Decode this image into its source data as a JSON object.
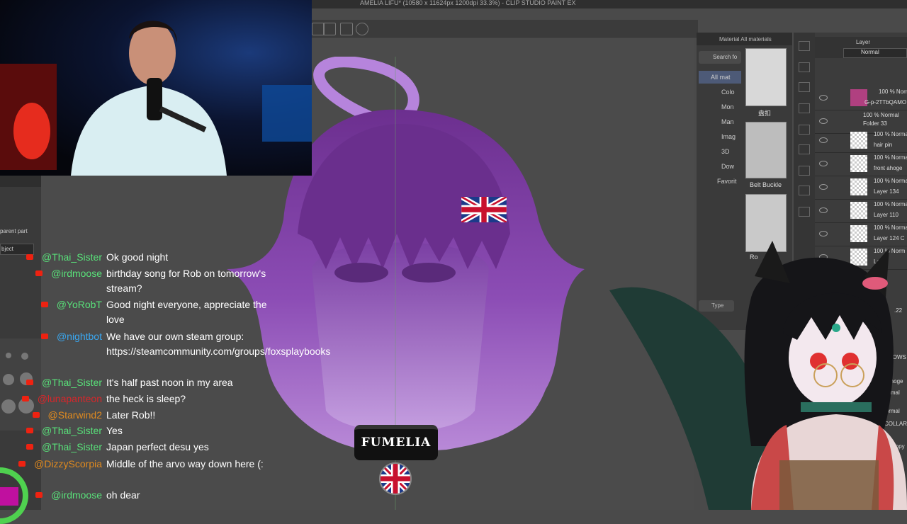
{
  "window": {
    "title": "AMELIA LIFU* (10580 x 11624px 1200dpi 33.3%) - CLIP STUDIO PAINT EX"
  },
  "material_panel": {
    "header": "Material  All materials",
    "search_label": "Search fo",
    "tree": [
      "All mat",
      "Colo",
      "Mon",
      "Man",
      "Imag",
      "3D",
      "Dow",
      "Favorit"
    ],
    "thumbs": [
      {
        "label": "盘扣"
      },
      {
        "label": "Belt Buckle"
      },
      {
        "label": "Ro"
      }
    ],
    "type_label": "Type"
  },
  "layer_panel": {
    "header": "Layer",
    "blend_mode": "Normal",
    "layers": [
      {
        "top": "100 % Norm",
        "name": "G-p-2TTbQAMO"
      },
      {
        "top": "100 % Normal",
        "name": "Folder 33"
      },
      {
        "top": "100 % Norma",
        "name": "hair pin"
      },
      {
        "top": "100 % Norma",
        "name": "front ahoge"
      },
      {
        "top": "100 % Norma",
        "name": "Layer 134"
      },
      {
        "top": "100 % Norma",
        "name": "Layer 110"
      },
      {
        "top": "100 % Norma",
        "name": "Layer 124 C"
      },
      {
        "top": "100 % Norm",
        "name": "Layer"
      }
    ],
    "partial_labels": [
      ".22",
      "ROWS",
      "k ahoge",
      "Normal",
      "Normal",
      "COLLAR",
      "Copy"
    ]
  },
  "left_panel": {
    "labels": [
      "parent part",
      "bject"
    ]
  },
  "artwork": {
    "badge_text": "FUMELIA"
  },
  "chat": {
    "messages": [
      {
        "user": "@Thai_Sister",
        "text": "Ok good night",
        "color": "#59e17a"
      },
      {
        "user": "@irdmoose",
        "text": "birthday song for Rob on tomorrow's stream?",
        "color": "#59e17a"
      },
      {
        "user": "@YoRobT",
        "text": "Good night everyone, appreciate the love",
        "color": "#59e17a"
      },
      {
        "user": "@nightbot",
        "text": "We have our own steam group: https://steamcommunity.com/groups/foxsplaybooks",
        "color": "#3aa7f0"
      },
      {
        "user": "@Thai_Sister",
        "text": "It's half past noon in my area",
        "color": "#59e17a"
      },
      {
        "user": "@lunapanteon",
        "text": "the heck is sleep?",
        "color": "#d8262a"
      },
      {
        "user": "@Starwind2",
        "text": "Later Rob!!",
        "color": "#e08a1f"
      },
      {
        "user": "@Thai_Sister",
        "text": "Yes",
        "color": "#59e17a"
      },
      {
        "user": "@Thai_Sister",
        "text": "Japan perfect desu yes",
        "color": "#59e17a"
      },
      {
        "user": "@DizzyScorpia",
        "text": "Middle of the arvo way down here (:",
        "color": "#e08a1f"
      },
      {
        "user": "@irdmoose",
        "text": "oh dear",
        "color": "#59e17a"
      }
    ]
  }
}
